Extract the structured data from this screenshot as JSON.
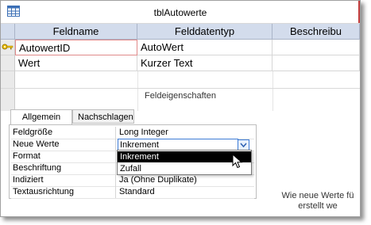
{
  "window": {
    "title": "tblAutowerte"
  },
  "grid": {
    "columns": [
      "Feldname",
      "Felddatentyp",
      "Beschreibu"
    ],
    "rows": [
      {
        "feldname": "AutowertID",
        "typ": "AutoWert",
        "beschreibung": "",
        "primary_key": true
      },
      {
        "feldname": "Wert",
        "typ": "Kurzer Text",
        "beschreibung": "",
        "primary_key": false
      }
    ]
  },
  "section_label": "Feldeigenschaften",
  "tabs": [
    "Allgemein",
    "Nachschlagen"
  ],
  "properties": [
    {
      "label": "Feldgröße",
      "value": "Long Integer"
    },
    {
      "label": "Neue Werte",
      "value": "Inkrement"
    },
    {
      "label": "Format",
      "value": ""
    },
    {
      "label": "Beschriftung",
      "value": ""
    },
    {
      "label": "Indiziert",
      "value": "Ja (Ohne Duplikate)"
    },
    {
      "label": "Textausrichtung",
      "value": "Standard"
    }
  ],
  "dropdown": {
    "options": [
      "Inkrement",
      "Zufall"
    ],
    "selected": "Inkrement"
  },
  "help_text": {
    "line1": "Wie neue Werte fü",
    "line2": "erstellt we"
  },
  "colors": {
    "header_bg": "#d3dcec",
    "active_border": "#e08a8a",
    "accent": "#c43e3e"
  },
  "icons": {
    "table": "table-icon",
    "key": "primary-key-icon",
    "dropdown": "chevron-down-icon",
    "cursor": "mouse-pointer-icon"
  }
}
